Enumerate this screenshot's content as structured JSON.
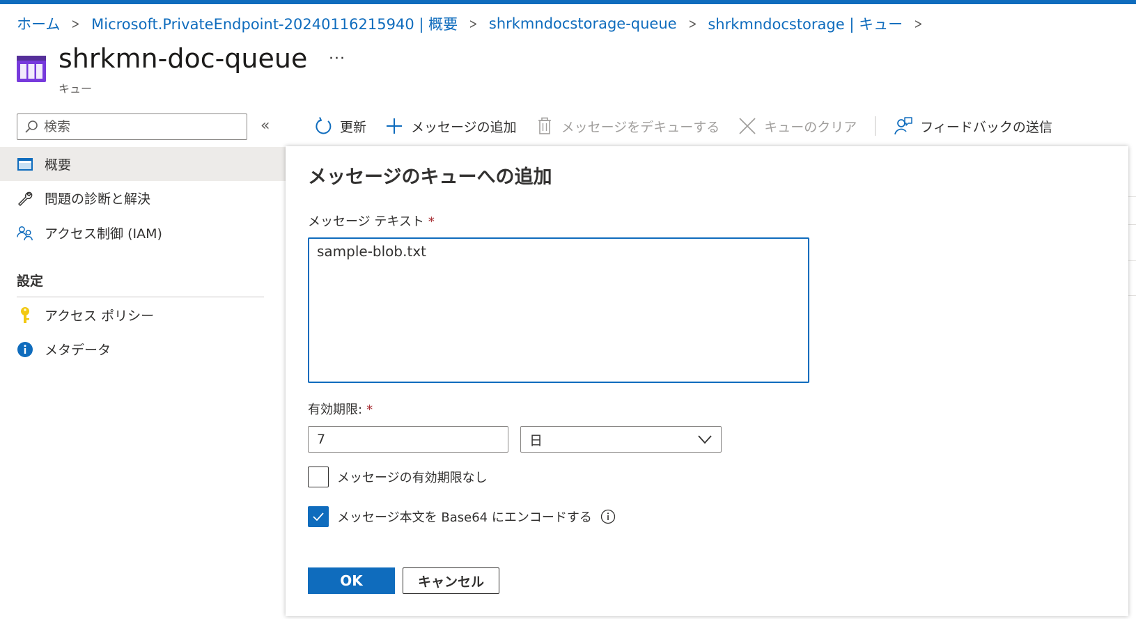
{
  "breadcrumb": [
    {
      "label": "ホーム"
    },
    {
      "label": "Microsoft.PrivateEndpoint-20240116215940 | 概要"
    },
    {
      "label": "shrkmndocstorage-queue"
    },
    {
      "label": "shrkmndocstorage | キュー"
    }
  ],
  "breadcrumb_separator": ">",
  "header": {
    "title": "shrkmn-doc-queue",
    "subtitle": "キュー",
    "more_label": "···"
  },
  "sidebar": {
    "search_placeholder": "検索",
    "collapse_label": "«",
    "items": [
      {
        "label": "概要",
        "icon": "overview-icon",
        "selected": true
      },
      {
        "label": "問題の診断と解決",
        "icon": "wrench-icon"
      },
      {
        "label": "アクセス制御 (IAM)",
        "icon": "people-icon"
      }
    ],
    "section_title": "設定",
    "settings_items": [
      {
        "label": "アクセス ポリシー",
        "icon": "key-icon"
      },
      {
        "label": "メタデータ",
        "icon": "info-icon"
      }
    ]
  },
  "toolbar": {
    "refresh": "更新",
    "add_message": "メッセージの追加",
    "dequeue": "メッセージをデキューする",
    "clear": "キューのクリア",
    "feedback": "フィードバックの送信"
  },
  "dialog": {
    "title": "メッセージのキューへの追加",
    "message_text_label": "メッセージ テキスト",
    "required_mark": "*",
    "message_text_value": "sample-blob.txt",
    "expiry_label": "有効期限:",
    "expiry_value": "7",
    "expiry_unit": "日",
    "no_expiry_label": "メッセージの有効期限なし",
    "no_expiry_checked": false,
    "base64_label": "メッセージ本文を Base64 にエンコードする",
    "base64_checked": true,
    "ok_label": "OK",
    "cancel_label": "キャンセル"
  },
  "colors": {
    "accent": "#0f6cbd",
    "required": "#a4262c",
    "selected_bg": "#edebe9"
  }
}
